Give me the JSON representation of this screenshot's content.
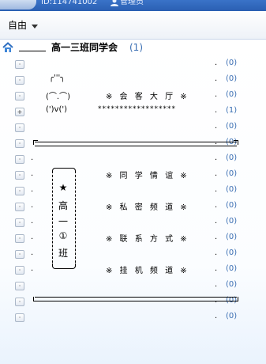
{
  "topbar": {
    "uid": "ID:114741002",
    "role": "管理员"
  },
  "toolbar": {
    "status": "自由"
  },
  "group": {
    "name": "高一三班同学会",
    "count": "(1)"
  },
  "rows": [
    {
      "toggle": "·",
      "count": "(0)"
    },
    {
      "toggle": "·",
      "count": "(0)"
    },
    {
      "toggle": "·",
      "count": "(0)"
    },
    {
      "toggle": "+",
      "count": "(1)"
    },
    {
      "toggle": "·",
      "count": "(0)"
    },
    {
      "toggle": "·",
      "count": "(0)"
    },
    {
      "toggle": "·",
      "count": "(0)"
    },
    {
      "toggle": "·",
      "count": "(0)"
    },
    {
      "toggle": "·",
      "count": "(0)"
    },
    {
      "toggle": "·",
      "count": "(0)"
    },
    {
      "toggle": "·",
      "count": "(0)"
    },
    {
      "toggle": "·",
      "count": "(0)"
    },
    {
      "toggle": "·",
      "count": "(0)"
    },
    {
      "toggle": "·",
      "count": "(0)"
    },
    {
      "toggle": "·",
      "count": "(0)"
    },
    {
      "toggle": "·",
      "count": "(0)"
    },
    {
      "toggle": "·",
      "count": "(0)"
    },
    {
      "toggle": "·",
      "count": "(0)"
    }
  ],
  "deco": {
    "face_top": "╭'''╮",
    "face_mid": "(⌒.⌒)",
    "face_bot": "(')v(')",
    "lobby": "※ 会 客 大 厅 ※",
    "stars": "******************",
    "classmates": "※ 同 学 情 谊 ※",
    "private": "※ 私 密 频 道 ※",
    "contact": "※ 联 系 方 式 ※",
    "idle": "※ 挂 机 频 道 ※",
    "vertical": [
      "★",
      "高",
      "一",
      "①",
      "班"
    ]
  }
}
